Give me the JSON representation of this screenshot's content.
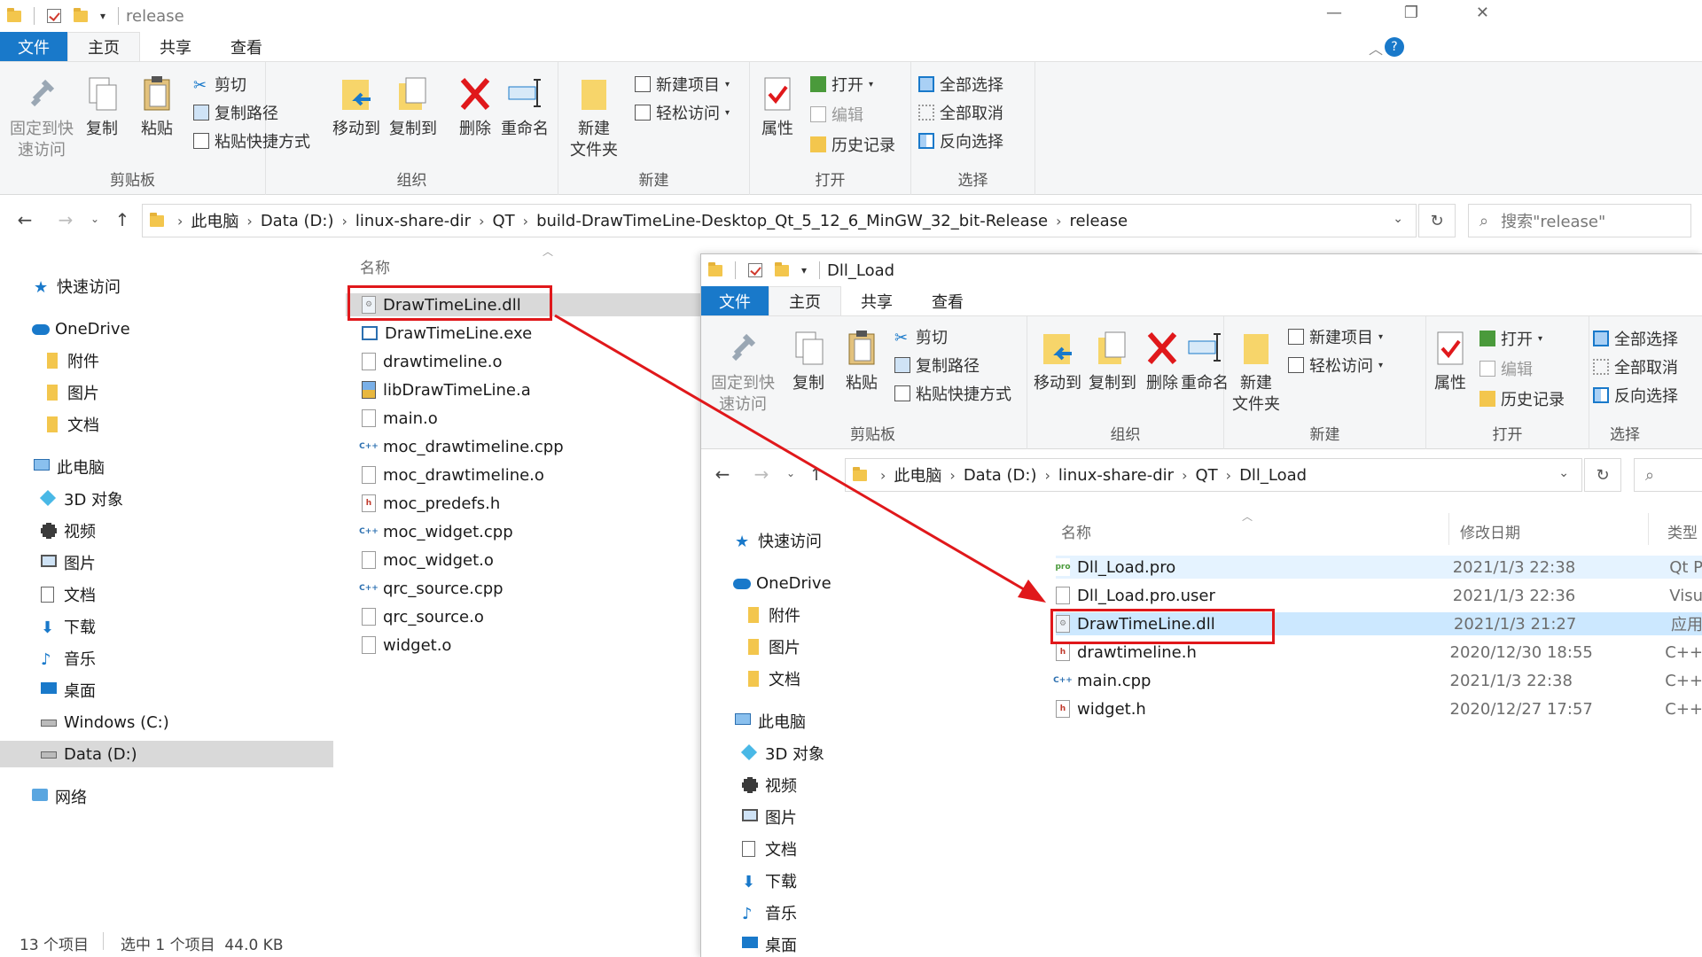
{
  "back_window": {
    "quick_access_dropdown": "▾",
    "title": "release",
    "tabs": [
      "文件",
      "主页",
      "共享",
      "查看"
    ],
    "window_controls": {
      "minimize": "—",
      "maximize": "❐",
      "close": "✕"
    },
    "ribbon": {
      "clipboard": {
        "label": "剪贴板",
        "pin": "固定到快\n速访问",
        "copy": "复制",
        "paste": "粘贴",
        "cut": "剪切",
        "copy_path": "复制路径",
        "paste_shortcut": "粘贴快捷方式"
      },
      "organize": {
        "label": "组织",
        "move_to": "移动到",
        "copy_to": "复制到",
        "delete": "删除",
        "rename": "重命名"
      },
      "new": {
        "label": "新建",
        "new_folder": "新建\n文件夹",
        "new_item": "新建项目",
        "easy_access": "轻松访问"
      },
      "open": {
        "label": "打开",
        "properties": "属性",
        "open": "打开",
        "edit": "编辑",
        "history": "历史记录"
      },
      "select": {
        "label": "选择",
        "select_all": "全部选择",
        "select_none": "全部取消",
        "invert": "反向选择"
      }
    },
    "address": {
      "crumbs": [
        "此电脑",
        "Data (D:)",
        "linux-share-dir",
        "QT",
        "build-DrawTimeLine-Desktop_Qt_5_12_6_MinGW_32_bit-Release",
        "release"
      ],
      "search_placeholder": "搜索\"release\""
    },
    "nav": [
      {
        "label": "快速访问",
        "icon": "star-icon"
      },
      {
        "label": "OneDrive",
        "icon": "cloud-icon"
      },
      {
        "label": "附件",
        "icon": "folder-icon"
      },
      {
        "label": "图片",
        "icon": "folder-icon"
      },
      {
        "label": "文档",
        "icon": "folder-icon"
      },
      {
        "label": "此电脑",
        "icon": "pc-icon"
      },
      {
        "label": "3D 对象",
        "icon": "cube-icon"
      },
      {
        "label": "视频",
        "icon": "video-icon"
      },
      {
        "label": "图片",
        "icon": "picture-icon"
      },
      {
        "label": "文档",
        "icon": "document-icon"
      },
      {
        "label": "下载",
        "icon": "download-icon"
      },
      {
        "label": "音乐",
        "icon": "music-icon"
      },
      {
        "label": "桌面",
        "icon": "desktop-icon"
      },
      {
        "label": "Windows (C:)",
        "icon": "drive-icon"
      },
      {
        "label": "Data (D:)",
        "icon": "drive-icon"
      },
      {
        "label": "网络",
        "icon": "network-icon"
      }
    ],
    "column_name": "名称",
    "files": [
      "DrawTimeLine.dll",
      "DrawTimeLine.exe",
      "drawtimeline.o",
      "libDrawTimeLine.a",
      "main.o",
      "moc_drawtimeline.cpp",
      "moc_drawtimeline.o",
      "moc_predefs.h",
      "moc_widget.cpp",
      "moc_widget.o",
      "qrc_source.cpp",
      "qrc_source.o",
      "widget.o"
    ],
    "file_icons": [
      "dll",
      "exe",
      "blank",
      "lib",
      "blank",
      "cpp",
      "blank",
      "h",
      "cpp",
      "blank",
      "cpp",
      "blank",
      "blank"
    ],
    "status": {
      "count": "13 个项目",
      "selected": "选中 1 个项目  44.0 KB"
    }
  },
  "front_window": {
    "quick_access_dropdown": "▾",
    "title": "Dll_Load",
    "tabs": [
      "文件",
      "主页",
      "共享",
      "查看"
    ],
    "ribbon": {
      "clipboard": {
        "label": "剪贴板",
        "pin": "固定到快\n速访问",
        "copy": "复制",
        "paste": "粘贴",
        "cut": "剪切",
        "copy_path": "复制路径",
        "paste_shortcut": "粘贴快捷方式"
      },
      "organize": {
        "label": "组织",
        "move_to": "移动到",
        "copy_to": "复制到",
        "delete": "删除",
        "rename": "重命名"
      },
      "new": {
        "label": "新建",
        "new_folder": "新建\n文件夹",
        "new_item": "新建项目",
        "easy_access": "轻松访问"
      },
      "open": {
        "label": "打开",
        "properties": "属性",
        "open": "打开",
        "edit": "编辑",
        "history": "历史记录"
      },
      "select": {
        "label": "选择",
        "select_all": "全部选择",
        "select_none": "全部取消",
        "invert": "反向选择"
      }
    },
    "address": {
      "crumbs": [
        "此电脑",
        "Data (D:)",
        "linux-share-dir",
        "QT",
        "Dll_Load"
      ]
    },
    "nav": [
      {
        "label": "快速访问",
        "icon": "star-icon"
      },
      {
        "label": "OneDrive",
        "icon": "cloud-icon"
      },
      {
        "label": "附件",
        "icon": "folder-icon"
      },
      {
        "label": "图片",
        "icon": "folder-icon"
      },
      {
        "label": "文档",
        "icon": "folder-icon"
      },
      {
        "label": "此电脑",
        "icon": "pc-icon"
      },
      {
        "label": "3D 对象",
        "icon": "cube-icon"
      },
      {
        "label": "视频",
        "icon": "video-icon"
      },
      {
        "label": "图片",
        "icon": "picture-icon"
      },
      {
        "label": "文档",
        "icon": "document-icon"
      },
      {
        "label": "下载",
        "icon": "download-icon"
      },
      {
        "label": "音乐",
        "icon": "music-icon"
      },
      {
        "label": "桌面",
        "icon": "desktop-icon"
      }
    ],
    "columns": {
      "name": "名称",
      "modified": "修改日期",
      "type": "类型"
    },
    "files": [
      {
        "name": "Dll_Load.pro",
        "date": "2021/1/3 22:38",
        "type": "Qt P",
        "icon": "pro"
      },
      {
        "name": "Dll_Load.pro.user",
        "date": "2021/1/3 22:36",
        "type": "Visu",
        "icon": "blank"
      },
      {
        "name": "DrawTimeLine.dll",
        "date": "2021/1/3 21:27",
        "type": "应用",
        "icon": "dll"
      },
      {
        "name": "drawtimeline.h",
        "date": "2020/12/30 18:55",
        "type": "C++",
        "icon": "h"
      },
      {
        "name": "main.cpp",
        "date": "2021/1/3 22:38",
        "type": "C++",
        "icon": "cpp"
      },
      {
        "name": "widget.h",
        "date": "2020/12/27 17:57",
        "type": "C++",
        "icon": "h"
      }
    ]
  },
  "colors": {
    "accent": "#1979ca",
    "highlight": "#e0181b",
    "selection": "#cce8ff",
    "hover": "#e5f3ff"
  }
}
